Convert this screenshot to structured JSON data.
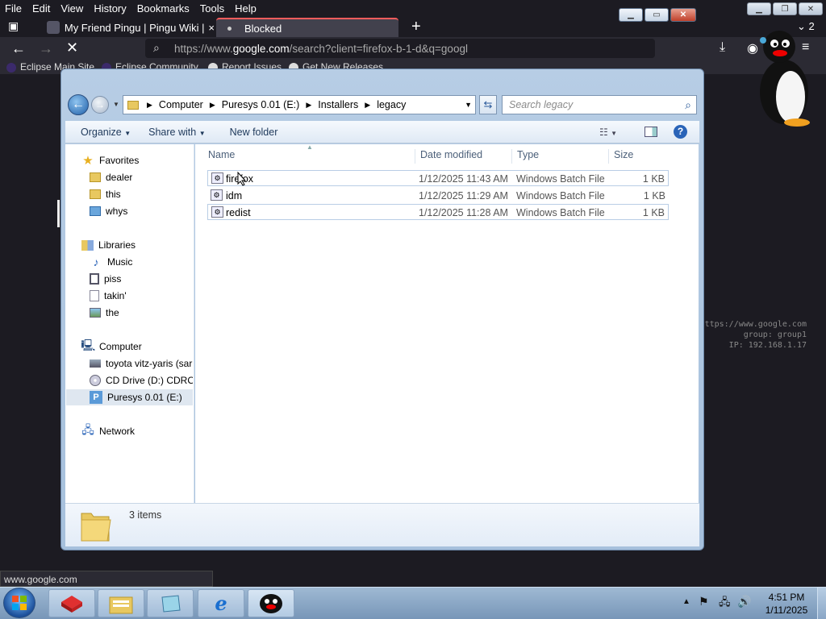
{
  "browser": {
    "menu": [
      "File",
      "Edit",
      "View",
      "History",
      "Bookmarks",
      "Tools",
      "Help"
    ],
    "tabs": [
      {
        "label": "My Friend Pingu | Pingu Wiki | F",
        "close": "×"
      },
      {
        "label": "Blocked",
        "close": "×"
      }
    ],
    "new_tab": "+",
    "tab_count": "2",
    "url_prefix": "https://www.",
    "url_domain": "google.com",
    "url_rest": "/search?client=firefox-b-1-d&q=googl",
    "bookmarks": [
      "Eclipse Main Site",
      "Eclipse Community",
      "Report Issues",
      "Get New Releases"
    ],
    "status_url": "www.google.com"
  },
  "overlay": {
    "line1": "https://www.google.com",
    "line2": "group: group1",
    "line3": "IP: 192.168.1.17"
  },
  "explorer": {
    "breadcrumb": [
      "Computer",
      "Puresys 0.01 (E:)",
      "Installers",
      "legacy"
    ],
    "search_placeholder": "Search legacy",
    "toolbar": {
      "organize": "Organize",
      "share": "Share with",
      "new_folder": "New folder"
    },
    "nav": {
      "favorites": "Favorites",
      "fav_items": [
        "dealer",
        "this",
        "whys"
      ],
      "libraries": "Libraries",
      "lib_items": [
        "Music",
        "piss",
        "takin'",
        "the"
      ],
      "computer": "Computer",
      "comp_items": [
        "toyota vitz-yaris (sar",
        "CD Drive (D:) CDROM",
        "Puresys 0.01 (E:)"
      ],
      "network": "Network"
    },
    "columns": {
      "name": "Name",
      "date": "Date modified",
      "type": "Type",
      "size": "Size"
    },
    "files": [
      {
        "name": "firefox",
        "date": "1/12/2025 11:43 AM",
        "type": "Windows Batch File",
        "size": "1 KB"
      },
      {
        "name": "idm",
        "date": "1/12/2025 11:29 AM",
        "type": "Windows Batch File",
        "size": "1 KB"
      },
      {
        "name": "redist",
        "date": "1/12/2025 11:28 AM",
        "type": "Windows Batch File",
        "size": "1 KB"
      }
    ],
    "item_count": "3 items"
  },
  "taskbar": {
    "time": "4:51 PM",
    "date": "1/11/2025"
  },
  "colors": {
    "tab_accent": "#ff5c5c",
    "explorer_frame": "#a6c0dc",
    "taskbar": "#7896b8"
  }
}
